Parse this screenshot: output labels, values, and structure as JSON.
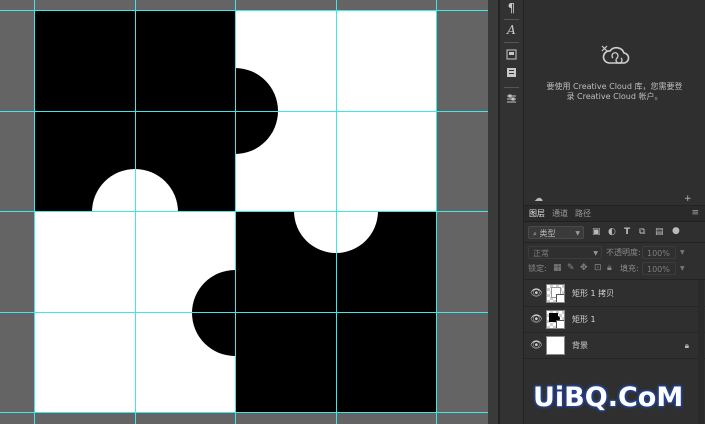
{
  "cc_panel": {
    "line1": "要使用 Creative Cloud 库，您需要登",
    "line2": "录 Creative Cloud 帐户。"
  },
  "layers_panel": {
    "tabs": [
      "图层",
      "通道",
      "路径"
    ],
    "active_tab": "图层",
    "filter_kind": "类型",
    "blend_mode": "正常",
    "opacity_label": "不透明度:",
    "opacity_value": "100%",
    "lock_label": "锁定:",
    "fill_label": "填充:",
    "fill_value": "100%",
    "layers": [
      {
        "name": "矩形 1 拷贝",
        "thumb": "white-shape",
        "visible": true
      },
      {
        "name": "矩形 1",
        "thumb": "black-shape",
        "visible": true
      },
      {
        "name": "背景",
        "thumb": "white",
        "visible": true,
        "locked": true
      }
    ]
  },
  "icons": {
    "strip": [
      "paragraph-icon",
      "character-icon",
      "properties-icon",
      "libraries-icon",
      "adjustments-icon"
    ],
    "cc_logo": "creative-cloud-disconnected-icon",
    "eye": "eye-icon",
    "lock": "lock-icon"
  },
  "colors": {
    "guide": "#3ee8e8",
    "canvas_black": "#000000",
    "canvas_white": "#ffffff",
    "workspace": "#646464",
    "panel_bg": "#2f2f2f"
  },
  "watermark": "UiBQ.CoM"
}
